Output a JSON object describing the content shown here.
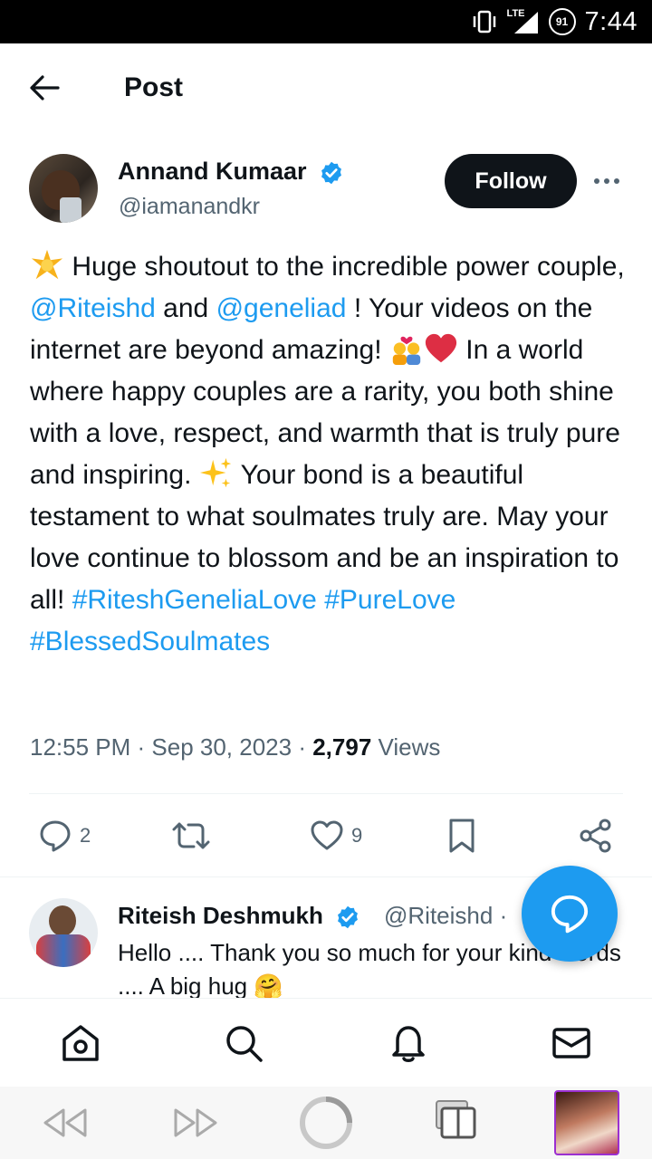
{
  "status_bar": {
    "time": "7:44",
    "battery": "91",
    "network": "LTE"
  },
  "header": {
    "title": "Post",
    "back_icon": "back-arrow-icon"
  },
  "post": {
    "author_name": "Annand Kumaar",
    "author_handle": "@iamanandkr",
    "verified": true,
    "follow_label": "Follow",
    "more_icon": "more-icon",
    "text_segments": [
      "Huge shoutout to the incredible power couple, ",
      "@Riteishd",
      " and ",
      "@geneliad",
      " ! Your videos on the internet are beyond amazing! ",
      " In a world where happy couples are a rarity, you both shine with a love, respect, and warmth that is truly pure and inspiring. ",
      " Your bond is a beautiful testament to what soulmates truly are. May your love continue to blossom and be an inspiration to all! ",
      "#RiteshGeneliaLove",
      " ",
      "#PureLove",
      "#BlessedSoulmates"
    ],
    "time": "12:55 PM",
    "date": "Sep 30, 2023",
    "views_count": "2,797",
    "views_label": "Views",
    "replies": "2",
    "likes": "9"
  },
  "reply": {
    "author_name": "Riteish Deshmukh",
    "author_handle": "@Riteishd",
    "separator": "·",
    "text": "Hello .... Thank you so much for your kind words .... A big hug 🤗"
  },
  "bottom_nav": [
    "home-icon",
    "search-icon",
    "notifications-icon",
    "messages-icon"
  ],
  "colors": {
    "accent": "#1d9bf0",
    "text": "#0f1419",
    "secondary": "#536471",
    "like_heart": "#e0245e"
  }
}
